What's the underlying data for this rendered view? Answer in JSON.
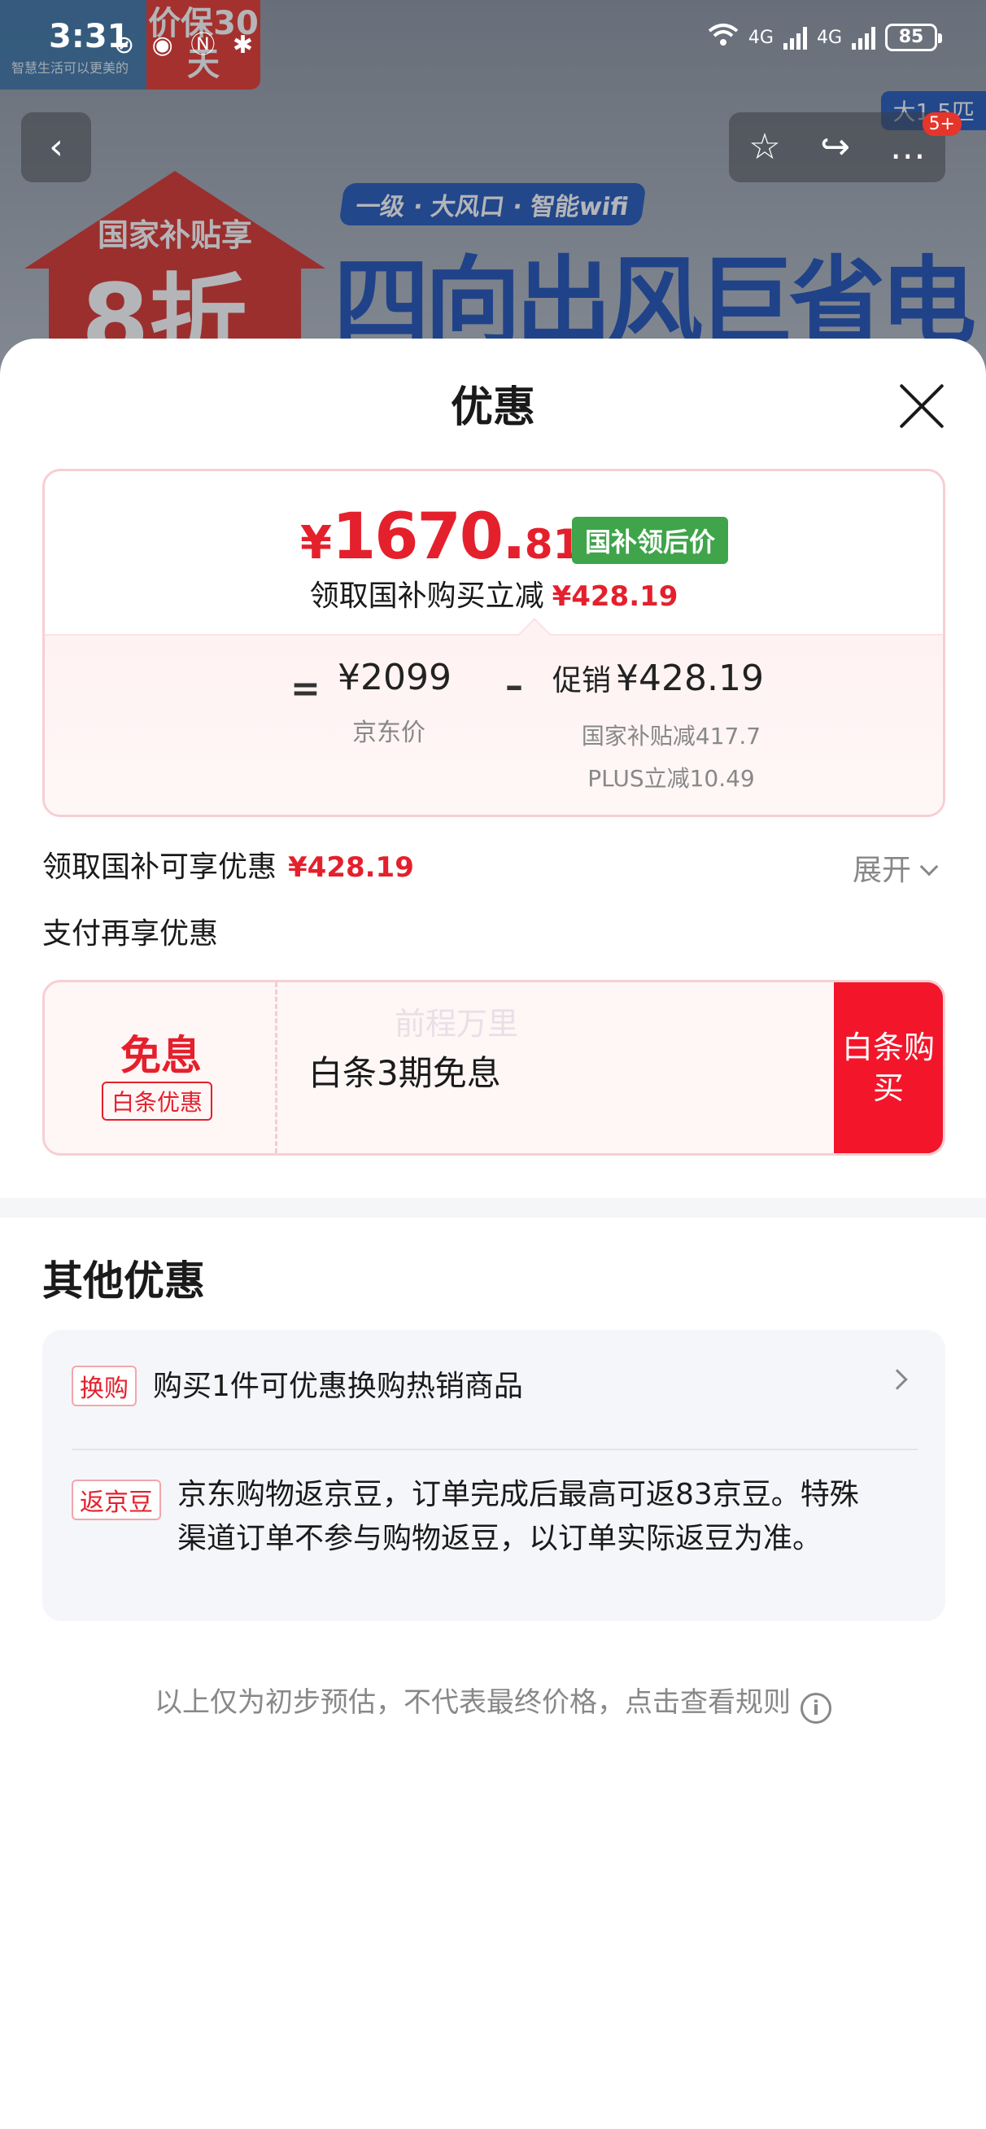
{
  "status_bar": {
    "time": "3:31",
    "icons_text": "⊘ ◉ Ⓝ ✱",
    "network_label_1": "4G",
    "network_label_2": "4G",
    "battery": "85"
  },
  "banner": {
    "price_guard": "价保30天",
    "slogan": "智慧生活可以更美的",
    "subsidy_label": "国家补贴享",
    "subsidy_big": "8折",
    "tagline": "一级 · 大风口 · 智能wifi",
    "headline": "四向出风巨省电",
    "size_tag": "大1.5匹",
    "cart_count": "5+"
  },
  "nav": {
    "back_icon": "‹",
    "star_icon": "☆",
    "share_icon": "↪",
    "more_icon": "…"
  },
  "sheet": {
    "title": "优惠",
    "price_card": {
      "currency": "¥",
      "final_int": "1670.",
      "final_dec": "81",
      "badge": "国补领后价",
      "reduce_text": "领取国补购买立减",
      "reduce_amount": "¥428.19",
      "eq": "=",
      "jd_price": "¥2099",
      "jd_label": "京东价",
      "minus": "–",
      "promo_label": "促销",
      "promo_amount": "¥428.19",
      "promo_sub_1": "国家补贴减417.7",
      "promo_sub_2": "PLUS立减10.49"
    },
    "claim_text": "领取国补可享优惠",
    "claim_amount": "¥428.19",
    "expand_label": "展开",
    "pay_heading": "支付再享优惠",
    "baitiao": {
      "free_label": "免息",
      "tag": "白条优惠",
      "text": "白条3期免息",
      "watermark": "前程万里",
      "buy_label": "白条购买"
    },
    "other_title": "其他优惠",
    "other_items": [
      {
        "tag": "换购",
        "text": "购买1件可优惠换购热销商品"
      },
      {
        "tag": "返京豆",
        "text": "京东购物返京豆，订单完成后最高可返83京豆。特殊渠道订单不参与购物返豆，以订单实际返豆为准。"
      }
    ],
    "footer_note": "以上仅为初步预估，不代表最终价格，点击查看规则",
    "info_icon": "i"
  },
  "colors": {
    "accent_red": "#e4202c",
    "badge_green": "#3fa44a",
    "buy_button_red": "#f3162b"
  }
}
